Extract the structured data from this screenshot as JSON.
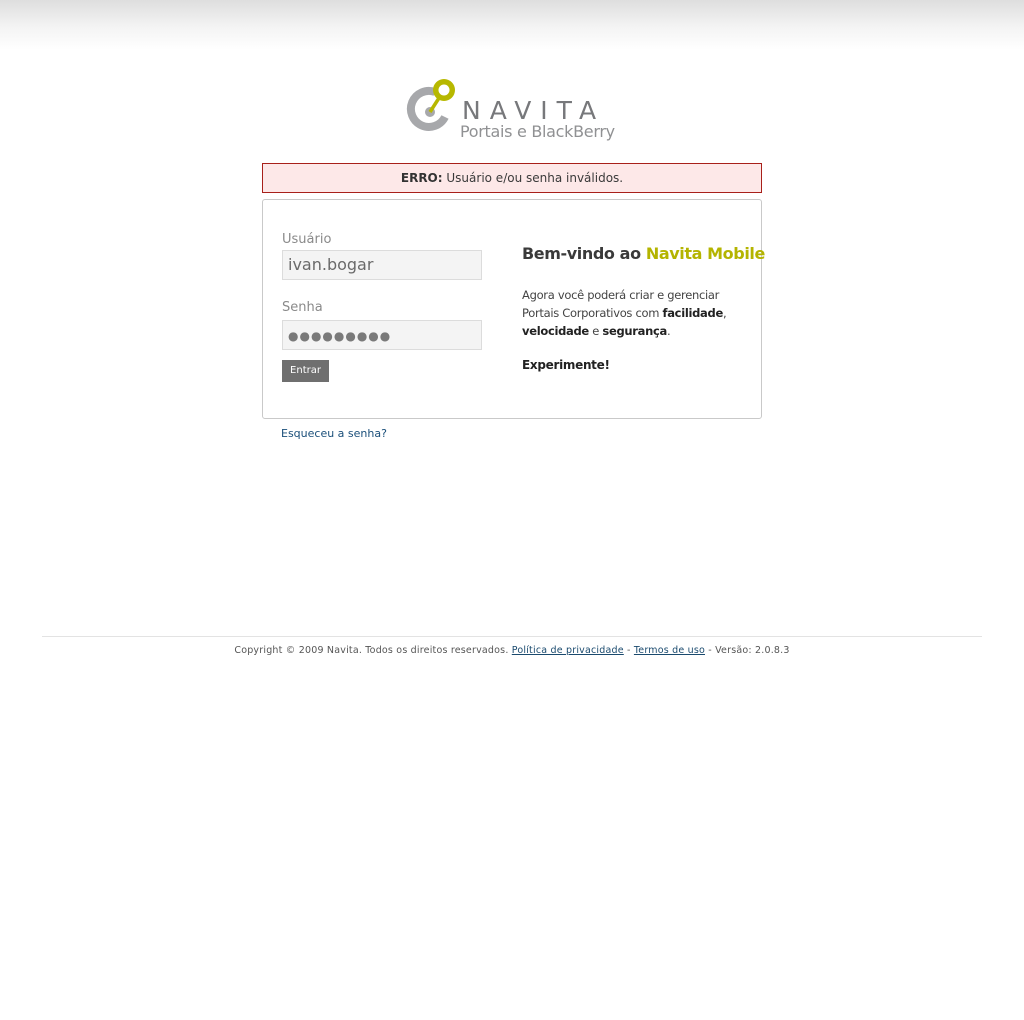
{
  "brand": {
    "logo_word": "NAVITA",
    "logo_sub": "Portais e BlackBerry",
    "colors": {
      "accent": "#b7b800",
      "gray": "#77787b"
    }
  },
  "error": {
    "label": "ERRO:",
    "message": "Usuário e/ou senha inválidos.",
    "color": "#a8201a"
  },
  "login": {
    "username_label": "Usuário",
    "username_value": "ivan.bogar",
    "password_label": "Senha",
    "password_mask": "●●●●●●●●●",
    "submit_label": "Entrar"
  },
  "welcome": {
    "title_prefix": "Bem-vindo ao ",
    "title_brand": "Navita Mobile",
    "text_1": "Agora você poderá criar e gerenciar Portais Corporativos com ",
    "bold_1": "facilidade",
    "sep_1": ", ",
    "bold_2": "velocidade",
    "sep_2": " e ",
    "bold_3": "segurança",
    "end": ".",
    "cta": "Experimente!"
  },
  "forgot_password": "Esqueceu a senha?",
  "footer": {
    "copyright": "Copyright © 2009 Navita. Todos os direitos reservados.",
    "privacy": "Política de privacidade",
    "dash": "-",
    "terms": "Termos de uso",
    "version": "- Versão: 2.0.8.3"
  }
}
